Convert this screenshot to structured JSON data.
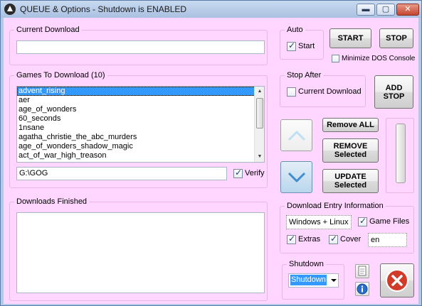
{
  "window": {
    "title": "QUEUE & Options - Shutdown is ENABLED",
    "minimize_glyph": "▬",
    "maximize_glyph": "▢",
    "close_glyph": "✕"
  },
  "current_download": {
    "label": "Current Download",
    "value": ""
  },
  "auto": {
    "label": "Auto",
    "start_label": "Start",
    "start_checked": true
  },
  "controls": {
    "start_label": "START",
    "stop_label": "STOP",
    "minimize_dos_label": "Minimize DOS Console",
    "minimize_dos_checked": false
  },
  "games": {
    "label": "Games To Download  (10)",
    "items": [
      "advent_rising",
      "aer",
      "age_of_wonders",
      "60_seconds",
      "1nsane",
      "agatha_christie_the_abc_murders",
      "age_of_wonders_shadow_magic",
      "act_of_war_high_treason"
    ],
    "selected_index": 0,
    "path_value": "G:\\GOG",
    "verify_label": "Verify",
    "verify_checked": true
  },
  "stop_after": {
    "label": "Stop After",
    "current_download_label": "Current Download",
    "checked": false,
    "add_stop_label": "ADD STOP"
  },
  "queue_buttons": {
    "remove_all_label": "Remove ALL",
    "remove_selected_label": "REMOVE Selected",
    "update_selected_label": "UPDATE Selected",
    "move_up_icon": "chevron-up-icon",
    "move_down_icon": "chevron-down-icon"
  },
  "downloads_finished": {
    "label": "Downloads Finished",
    "items": []
  },
  "entry_info": {
    "label": "Download Entry Information",
    "platform_value": "Windows + Linux",
    "game_files_label": "Game Files",
    "game_files_checked": true,
    "extras_label": "Extras",
    "extras_checked": true,
    "cover_label": "Cover",
    "cover_checked": true,
    "language_value": "en"
  },
  "shutdown": {
    "label": "Shutdown",
    "selected_option": "Shutdown"
  },
  "colors": {
    "client_background": "#ffd6ff",
    "selection": "#3399ff",
    "close_red": "#c4452f"
  }
}
